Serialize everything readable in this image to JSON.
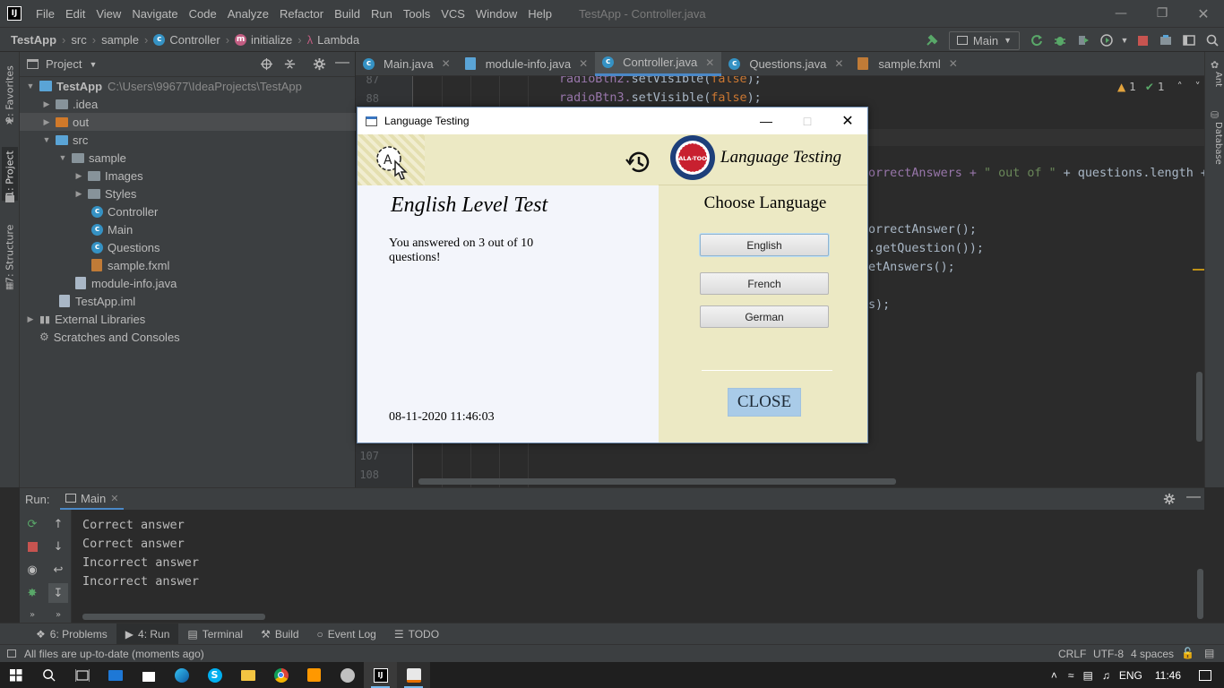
{
  "menubar": {
    "items": [
      "File",
      "Edit",
      "View",
      "Navigate",
      "Code",
      "Analyze",
      "Refactor",
      "Build",
      "Run",
      "Tools",
      "VCS",
      "Window",
      "Help"
    ],
    "window_title": "TestApp - Controller.java"
  },
  "navbar": {
    "project": "TestApp",
    "src": "src",
    "pkg": "sample",
    "cls": "Controller",
    "method": "initialize",
    "lambda": "Lambda",
    "run_config": "Main"
  },
  "sidestrips": {
    "favorites": "2: Favorites",
    "project": "1: Project",
    "structure": "7: Structure",
    "ant": "Ant",
    "database": "Database"
  },
  "project_panel": {
    "title": "Project",
    "tree": {
      "root": "TestApp",
      "root_path": "C:\\Users\\99677\\IdeaProjects\\TestApp",
      "idea": ".idea",
      "out": "out",
      "src": "src",
      "sample": "sample",
      "images": "Images",
      "styles": "Styles",
      "controller": "Controller",
      "main": "Main",
      "questions": "Questions",
      "sample_fxml": "sample.fxml",
      "module_info": "module-info.java",
      "iml": "TestApp.iml",
      "ext_libs": "External Libraries",
      "scratches": "Scratches and Consoles"
    }
  },
  "editor": {
    "tabs": {
      "t1": "Main.java",
      "t2": "module-info.java",
      "t3": "Controller.java",
      "t4": "Questions.java",
      "t5": "sample.fxml"
    },
    "line_numbers": {
      "l87": "87",
      "l88": "88",
      "l107": "107",
      "l108": "108"
    },
    "code": {
      "l87a": "radioBtn2.",
      "l87b": "setVisible(",
      "l87c": "false",
      "l87d": ");",
      "l88a": "radioBtn3.",
      "l88b": "setVisible(",
      "l88c": "false",
      "l88d": ");",
      "c1a": "orrectAnswers + ",
      "c1b": "\" out of \"",
      "c1c": " + questions.length +",
      "c2": "orrectAnswer();",
      "c3": ".getQuestion());",
      "c4": "etAnswers();",
      "c5": "s);"
    },
    "inspections": {
      "warnings": "1",
      "weak": "1"
    }
  },
  "run_panel": {
    "label": "Run:",
    "tab": "Main",
    "output": [
      "Correct answer",
      "Correct answer",
      "Incorrect answer",
      "Incorrect answer"
    ]
  },
  "tool_buttons": {
    "problems": "6: Problems",
    "run": "4: Run",
    "terminal": "Terminal",
    "build": "Build",
    "event_log": "Event Log",
    "todo": "TODO"
  },
  "status_bar": {
    "message": "All files are up-to-date (moments ago)",
    "line_sep": "CRLF",
    "encoding": "UTF-8",
    "indent": "4 spaces"
  },
  "taskbar": {
    "lang": "ENG",
    "time": "11:46"
  },
  "dialog": {
    "title": "Language Testing",
    "heading": "English Level Test",
    "result": "You answered on 3 out of 10 questions!",
    "datetime": "08-11-2020 11:46:03",
    "brand": "Language Testing",
    "logo_text": "ALA-TOO",
    "choose_label": "Choose Language",
    "languages": {
      "en": "English",
      "fr": "French",
      "de": "German"
    },
    "close_label": "CLOSE"
  },
  "colors": {
    "ide_bg": "#2b2b2b",
    "ide_panel": "#3c3f41",
    "dialog_banner": "#ece9c4",
    "close_button": "#a9cbe8"
  }
}
